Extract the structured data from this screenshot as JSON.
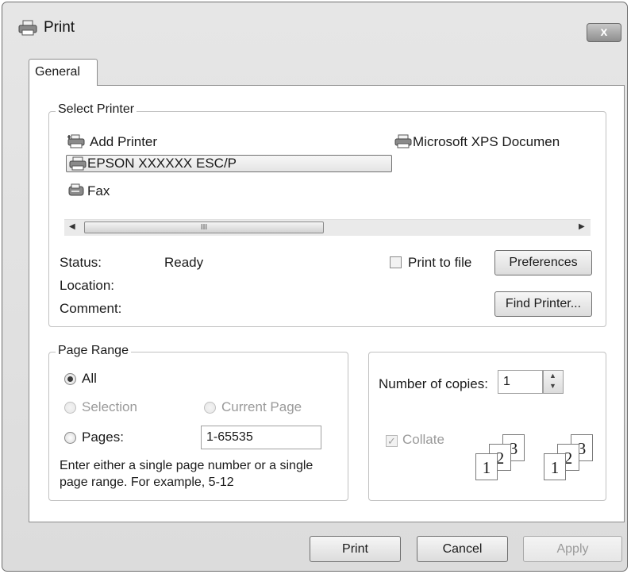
{
  "window": {
    "title": "Print",
    "close_label": "x"
  },
  "tabs": [
    {
      "label": "General"
    }
  ],
  "select_printer": {
    "legend": "Select Printer",
    "printers": [
      {
        "name": "Add Printer",
        "icon": "add-printer-icon"
      },
      {
        "name": "Microsoft XPS Documen",
        "icon": "printer-icon"
      },
      {
        "name": "EPSON XXXXXX ESC/P",
        "icon": "printer-icon",
        "selected": true
      },
      {
        "name": "Fax",
        "icon": "fax-icon"
      }
    ],
    "scroll_thumb_label": "III",
    "status_label": "Status:",
    "status_value": "Ready",
    "location_label": "Location:",
    "comment_label": "Comment:",
    "print_to_file_label": "Print to file",
    "print_to_file_checked": false,
    "preferences_label": "Preferences",
    "find_printer_label": "Find Printer..."
  },
  "page_range": {
    "legend": "Page Range",
    "all_label": "All",
    "selection_label": "Selection",
    "current_page_label": "Current Page",
    "pages_label": "Pages:",
    "pages_value": "1-65535",
    "selected_option": "All",
    "hint": "Enter either a single page number or a single page range.  For example, 5-12"
  },
  "copies": {
    "label": "Number of copies:",
    "value": "1",
    "collate_label": "Collate",
    "collate_checked": true,
    "collate_pages": [
      "1",
      "2",
      "3"
    ]
  },
  "buttons": {
    "print": "Print",
    "cancel": "Cancel",
    "apply": "Apply"
  },
  "colors": {
    "selection_border": "#707070",
    "disabled_text": "#9a9a9a"
  }
}
